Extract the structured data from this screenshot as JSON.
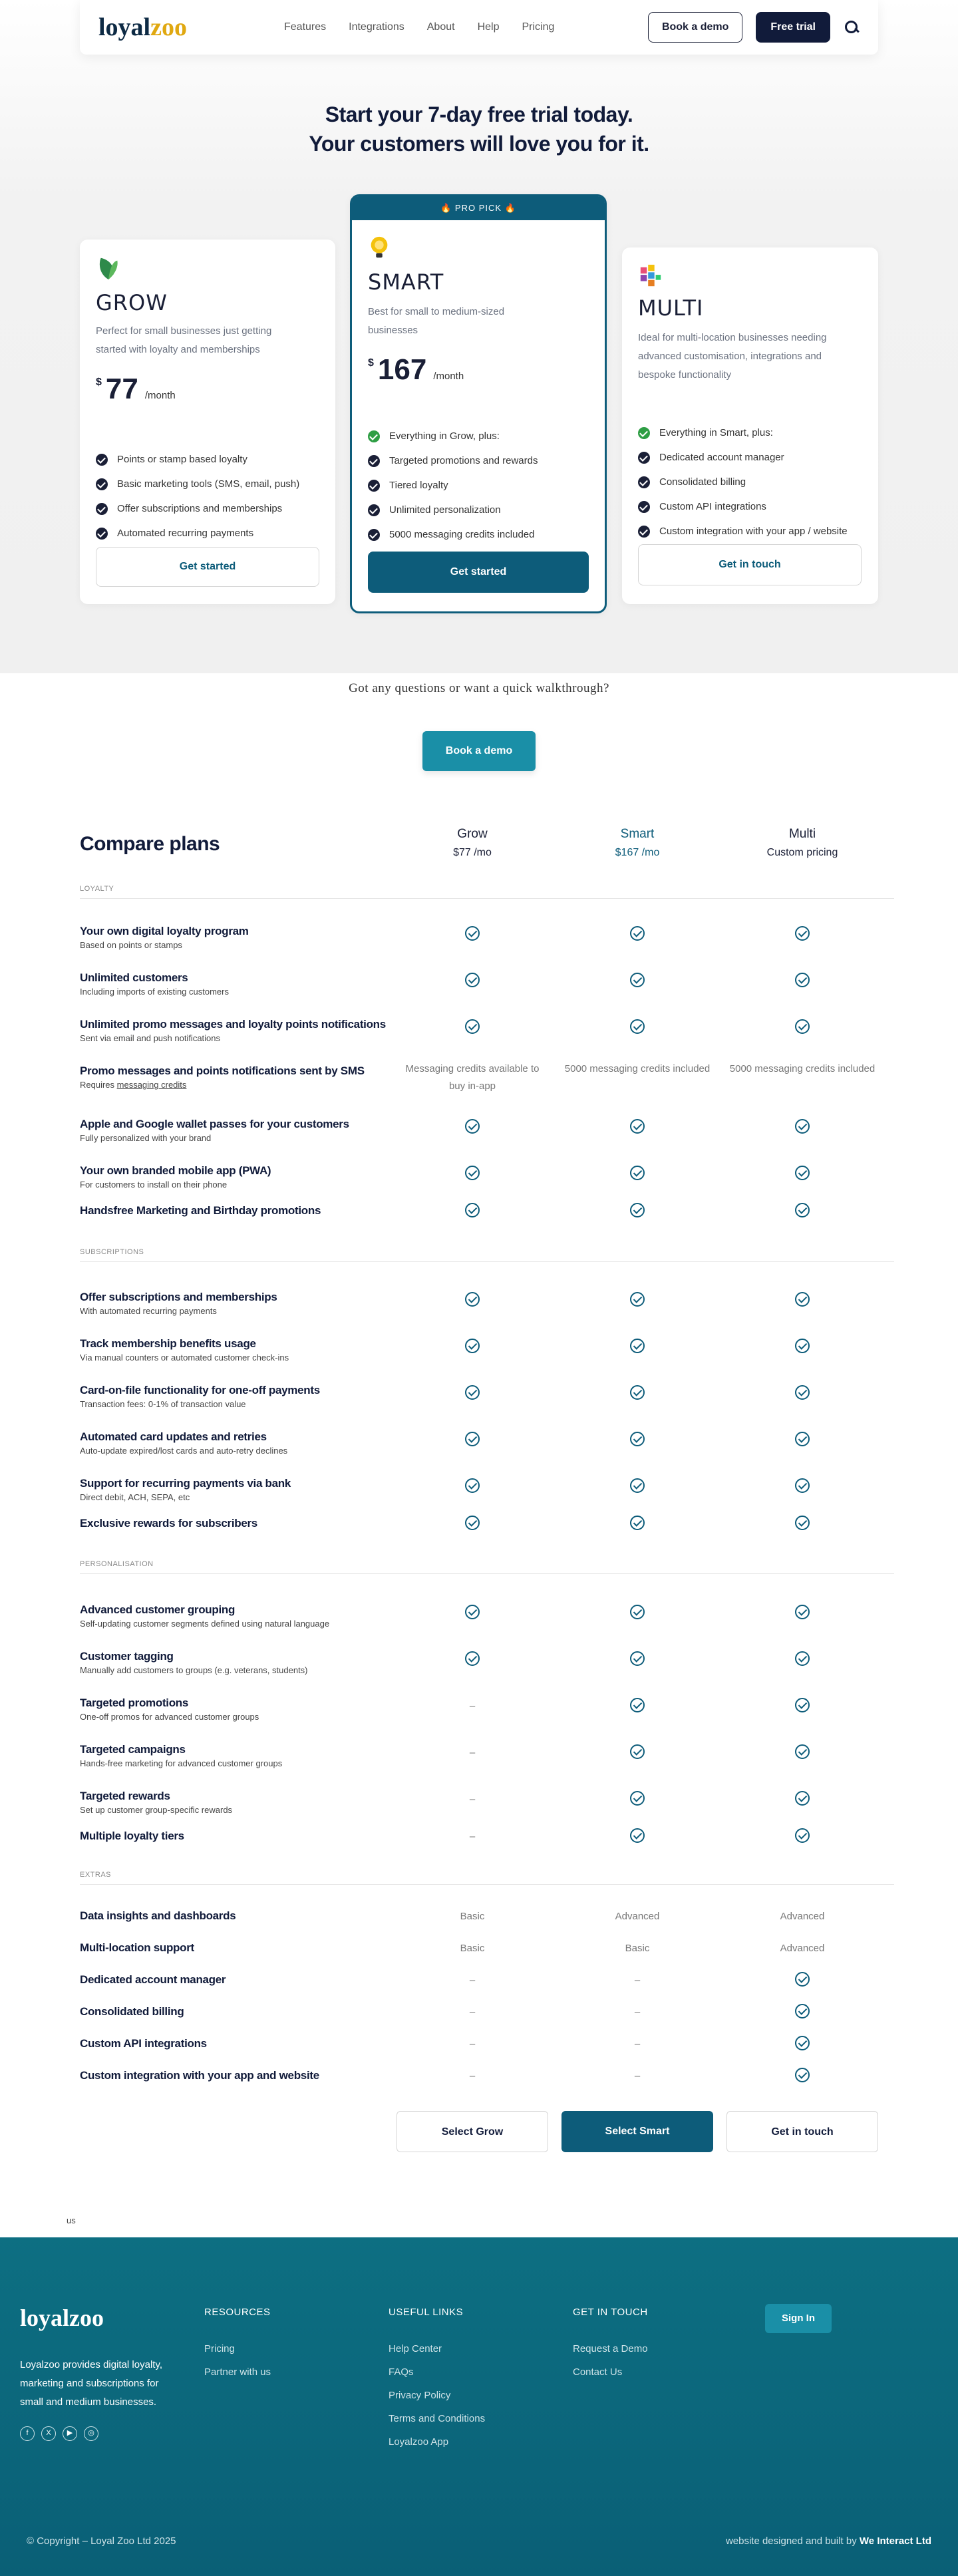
{
  "nav": {
    "logo_a": "loyal",
    "logo_b": "zoo",
    "links": [
      "Features",
      "Integrations",
      "About",
      "Help",
      "Pricing"
    ],
    "book_demo": "Book a demo",
    "free_trial": "Free trial"
  },
  "hero": {
    "line1": "Start your 7-day free trial today.",
    "line2": "Your customers will love you for it."
  },
  "plans": {
    "grow": {
      "name": "GROW",
      "desc": "Perfect for small businesses just getting started with loyalty and memberships",
      "currency": "$",
      "price": "77",
      "per": "/month",
      "features": [
        "Points or stamp based loyalty",
        "Basic marketing tools (SMS, email, push)",
        "Offer subscriptions and memberships",
        "Automated recurring payments"
      ],
      "cta": "Get started"
    },
    "smart": {
      "badge": "🔥 PRO PICK 🔥",
      "name": "SMART",
      "desc": "Best for small to medium-sized businesses",
      "currency": "$",
      "price": "167",
      "per": "/month",
      "features": [
        "Everything in Grow, plus:",
        "Targeted promotions and rewards",
        "Tiered loyalty",
        "Unlimited personalization",
        "5000 messaging credits included"
      ],
      "cta": "Get started"
    },
    "multi": {
      "name": "MULTI",
      "desc": "Ideal for multi-location businesses needing advanced customisation, integrations and bespoke functionality",
      "features": [
        "Everything in Smart, plus:",
        "Dedicated account manager",
        "Consolidated billing",
        "Custom API integrations",
        "Custom integration with your app / website"
      ],
      "cta": "Get in touch"
    }
  },
  "question": "Got any questions or want a quick walkthrough?",
  "book_demo_btn": "Book a demo",
  "compare": {
    "title": "Compare plans",
    "cols": [
      {
        "name": "Grow",
        "price": "$77 /mo"
      },
      {
        "name": "Smart",
        "price": "$167 /mo"
      },
      {
        "name": "Multi",
        "price": "Custom pricing"
      }
    ],
    "sections": {
      "loyalty": "LOYALTY",
      "subscriptions": "SUBSCRIPTIONS",
      "personalisation": "PERSONALISATION",
      "extras": "EXTRAS"
    },
    "rows": [
      {
        "t": "Your own digital loyalty program",
        "s": "Based on points or stamps",
        "v": [
          "check",
          "check",
          "check"
        ]
      },
      {
        "t": "Unlimited customers",
        "s": "Including imports of existing customers",
        "v": [
          "check",
          "check",
          "check"
        ]
      },
      {
        "t": "Unlimited promo messages and loyalty points notifications",
        "s": "Sent via email and push notifications",
        "v": [
          "check",
          "check",
          "check"
        ]
      },
      {
        "t": "Promo messages and points notifications sent by SMS",
        "s": "Requires ",
        "link": "messaging credits",
        "v": [
          "Messaging credits available to buy in-app",
          "5000 messaging credits included",
          "5000 messaging credits included"
        ]
      },
      {
        "t": "Apple and Google wallet passes for your customers",
        "s": "Fully personalized with your brand",
        "v": [
          "check",
          "check",
          "check"
        ]
      },
      {
        "t": "Your own branded mobile app (PWA)",
        "s": "For customers to install on their phone",
        "v": [
          "check",
          "check",
          "check"
        ]
      },
      {
        "t": "Handsfree Marketing and Birthday promotions",
        "s": "",
        "v": [
          "check",
          "check",
          "check"
        ]
      },
      {
        "t": "Offer subscriptions and memberships",
        "s": "With automated recurring payments",
        "v": [
          "check",
          "check",
          "check"
        ]
      },
      {
        "t": "Track membership benefits usage",
        "s": "Via manual counters or automated customer check-ins",
        "v": [
          "check",
          "check",
          "check"
        ]
      },
      {
        "t": "Card-on-file functionality for one-off payments",
        "s": "Transaction fees: 0-1% of transaction value",
        "v": [
          "check",
          "check",
          "check"
        ]
      },
      {
        "t": "Automated card updates and retries",
        "s": "Auto-update expired/lost cards and auto-retry declines",
        "v": [
          "check",
          "check",
          "check"
        ]
      },
      {
        "t": "Support for recurring payments via bank",
        "s": "Direct debit, ACH, SEPA, etc",
        "v": [
          "check",
          "check",
          "check"
        ]
      },
      {
        "t": "Exclusive rewards for subscribers",
        "s": "",
        "v": [
          "check",
          "check",
          "check"
        ]
      },
      {
        "t": "Advanced customer grouping",
        "s": "Self-updating customer segments defined using natural language",
        "v": [
          "check",
          "check",
          "check"
        ]
      },
      {
        "t": "Customer tagging",
        "s": "Manually add customers to groups (e.g. veterans, students)",
        "v": [
          "check",
          "check",
          "check"
        ]
      },
      {
        "t": "Targeted promotions",
        "s": "One-off promos for advanced customer groups",
        "v": [
          "–",
          "check",
          "check"
        ]
      },
      {
        "t": "Targeted campaigns",
        "s": "Hands-free marketing for advanced customer groups",
        "v": [
          "–",
          "check",
          "check"
        ]
      },
      {
        "t": "Targeted rewards",
        "s": "Set up customer group-specific rewards",
        "v": [
          "–",
          "check",
          "check"
        ]
      },
      {
        "t": "Multiple loyalty tiers",
        "s": "",
        "v": [
          "–",
          "check",
          "check"
        ]
      },
      {
        "t": "Data insights and dashboards",
        "s": "",
        "v": [
          "Basic",
          "Advanced",
          "Advanced"
        ]
      },
      {
        "t": "Multi-location support",
        "s": "",
        "v": [
          "Basic",
          "Basic",
          "Advanced"
        ]
      },
      {
        "t": "Dedicated account manager",
        "s": "",
        "v": [
          "–",
          "–",
          "check"
        ]
      },
      {
        "t": "Consolidated billing",
        "s": "",
        "v": [
          "–",
          "–",
          "check"
        ]
      },
      {
        "t": "Custom API integrations",
        "s": "",
        "v": [
          "–",
          "–",
          "check"
        ]
      },
      {
        "t": "Custom integration with your app and website",
        "s": "",
        "v": [
          "–",
          "–",
          "check"
        ]
      }
    ],
    "select": [
      "Select Grow",
      "Select Smart",
      "Get in touch"
    ]
  },
  "us": "us",
  "footer": {
    "logo_a": "loyal",
    "logo_b": "zoo",
    "about": "Loyalzoo provides digital loyalty, marketing and subscriptions for small and medium businesses.",
    "resources": {
      "title": "RESOURCES",
      "links": [
        "Pricing",
        "Partner with us"
      ]
    },
    "useful": {
      "title": "USEFUL LINKS",
      "links": [
        "Help Center",
        "FAQs",
        "Privacy Policy",
        "Terms and Conditions",
        "Loyalzoo App"
      ]
    },
    "touch": {
      "title": "GET IN TOUCH",
      "links": [
        "Request a Demo",
        "Contact Us"
      ]
    },
    "signin": "Sign In",
    "copyright": "© Copyright – Loyal Zoo Ltd 2025",
    "built": "website designed and built by ",
    "builder": "We Interact Ltd"
  },
  "colors": {
    "primary": "#0d5c7a",
    "accent": "#1a8fa7",
    "dark": "#111b3a",
    "brand_yellow": "#e0a810",
    "green": "#2e9e44"
  }
}
